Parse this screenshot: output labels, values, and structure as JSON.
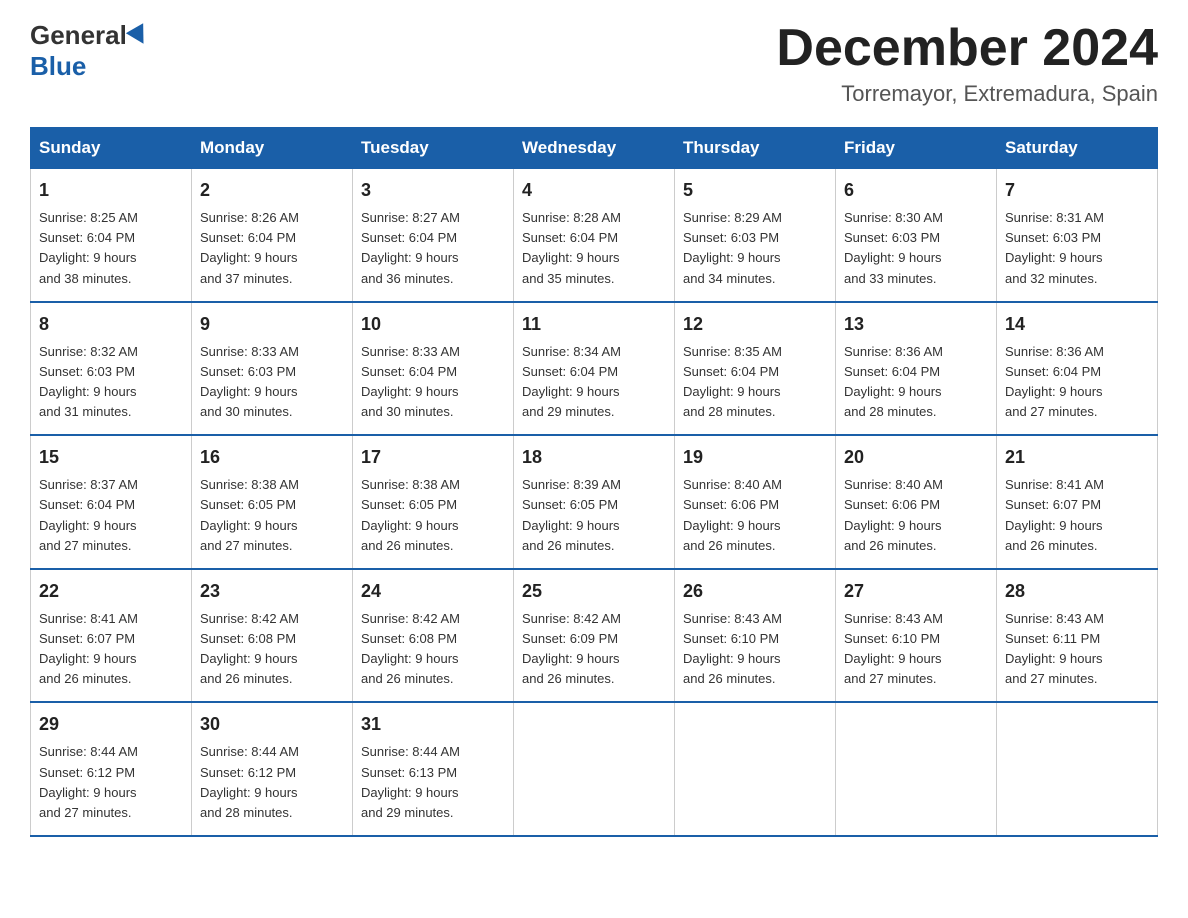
{
  "header": {
    "logo_general": "General",
    "logo_blue": "Blue",
    "month_title": "December 2024",
    "location": "Torremayor, Extremadura, Spain"
  },
  "weekdays": [
    "Sunday",
    "Monday",
    "Tuesday",
    "Wednesday",
    "Thursday",
    "Friday",
    "Saturday"
  ],
  "weeks": [
    [
      {
        "day": "1",
        "info": "Sunrise: 8:25 AM\nSunset: 6:04 PM\nDaylight: 9 hours\nand 38 minutes."
      },
      {
        "day": "2",
        "info": "Sunrise: 8:26 AM\nSunset: 6:04 PM\nDaylight: 9 hours\nand 37 minutes."
      },
      {
        "day": "3",
        "info": "Sunrise: 8:27 AM\nSunset: 6:04 PM\nDaylight: 9 hours\nand 36 minutes."
      },
      {
        "day": "4",
        "info": "Sunrise: 8:28 AM\nSunset: 6:04 PM\nDaylight: 9 hours\nand 35 minutes."
      },
      {
        "day": "5",
        "info": "Sunrise: 8:29 AM\nSunset: 6:03 PM\nDaylight: 9 hours\nand 34 minutes."
      },
      {
        "day": "6",
        "info": "Sunrise: 8:30 AM\nSunset: 6:03 PM\nDaylight: 9 hours\nand 33 minutes."
      },
      {
        "day": "7",
        "info": "Sunrise: 8:31 AM\nSunset: 6:03 PM\nDaylight: 9 hours\nand 32 minutes."
      }
    ],
    [
      {
        "day": "8",
        "info": "Sunrise: 8:32 AM\nSunset: 6:03 PM\nDaylight: 9 hours\nand 31 minutes."
      },
      {
        "day": "9",
        "info": "Sunrise: 8:33 AM\nSunset: 6:03 PM\nDaylight: 9 hours\nand 30 minutes."
      },
      {
        "day": "10",
        "info": "Sunrise: 8:33 AM\nSunset: 6:04 PM\nDaylight: 9 hours\nand 30 minutes."
      },
      {
        "day": "11",
        "info": "Sunrise: 8:34 AM\nSunset: 6:04 PM\nDaylight: 9 hours\nand 29 minutes."
      },
      {
        "day": "12",
        "info": "Sunrise: 8:35 AM\nSunset: 6:04 PM\nDaylight: 9 hours\nand 28 minutes."
      },
      {
        "day": "13",
        "info": "Sunrise: 8:36 AM\nSunset: 6:04 PM\nDaylight: 9 hours\nand 28 minutes."
      },
      {
        "day": "14",
        "info": "Sunrise: 8:36 AM\nSunset: 6:04 PM\nDaylight: 9 hours\nand 27 minutes."
      }
    ],
    [
      {
        "day": "15",
        "info": "Sunrise: 8:37 AM\nSunset: 6:04 PM\nDaylight: 9 hours\nand 27 minutes."
      },
      {
        "day": "16",
        "info": "Sunrise: 8:38 AM\nSunset: 6:05 PM\nDaylight: 9 hours\nand 27 minutes."
      },
      {
        "day": "17",
        "info": "Sunrise: 8:38 AM\nSunset: 6:05 PM\nDaylight: 9 hours\nand 26 minutes."
      },
      {
        "day": "18",
        "info": "Sunrise: 8:39 AM\nSunset: 6:05 PM\nDaylight: 9 hours\nand 26 minutes."
      },
      {
        "day": "19",
        "info": "Sunrise: 8:40 AM\nSunset: 6:06 PM\nDaylight: 9 hours\nand 26 minutes."
      },
      {
        "day": "20",
        "info": "Sunrise: 8:40 AM\nSunset: 6:06 PM\nDaylight: 9 hours\nand 26 minutes."
      },
      {
        "day": "21",
        "info": "Sunrise: 8:41 AM\nSunset: 6:07 PM\nDaylight: 9 hours\nand 26 minutes."
      }
    ],
    [
      {
        "day": "22",
        "info": "Sunrise: 8:41 AM\nSunset: 6:07 PM\nDaylight: 9 hours\nand 26 minutes."
      },
      {
        "day": "23",
        "info": "Sunrise: 8:42 AM\nSunset: 6:08 PM\nDaylight: 9 hours\nand 26 minutes."
      },
      {
        "day": "24",
        "info": "Sunrise: 8:42 AM\nSunset: 6:08 PM\nDaylight: 9 hours\nand 26 minutes."
      },
      {
        "day": "25",
        "info": "Sunrise: 8:42 AM\nSunset: 6:09 PM\nDaylight: 9 hours\nand 26 minutes."
      },
      {
        "day": "26",
        "info": "Sunrise: 8:43 AM\nSunset: 6:10 PM\nDaylight: 9 hours\nand 26 minutes."
      },
      {
        "day": "27",
        "info": "Sunrise: 8:43 AM\nSunset: 6:10 PM\nDaylight: 9 hours\nand 27 minutes."
      },
      {
        "day": "28",
        "info": "Sunrise: 8:43 AM\nSunset: 6:11 PM\nDaylight: 9 hours\nand 27 minutes."
      }
    ],
    [
      {
        "day": "29",
        "info": "Sunrise: 8:44 AM\nSunset: 6:12 PM\nDaylight: 9 hours\nand 27 minutes."
      },
      {
        "day": "30",
        "info": "Sunrise: 8:44 AM\nSunset: 6:12 PM\nDaylight: 9 hours\nand 28 minutes."
      },
      {
        "day": "31",
        "info": "Sunrise: 8:44 AM\nSunset: 6:13 PM\nDaylight: 9 hours\nand 29 minutes."
      },
      null,
      null,
      null,
      null
    ]
  ]
}
